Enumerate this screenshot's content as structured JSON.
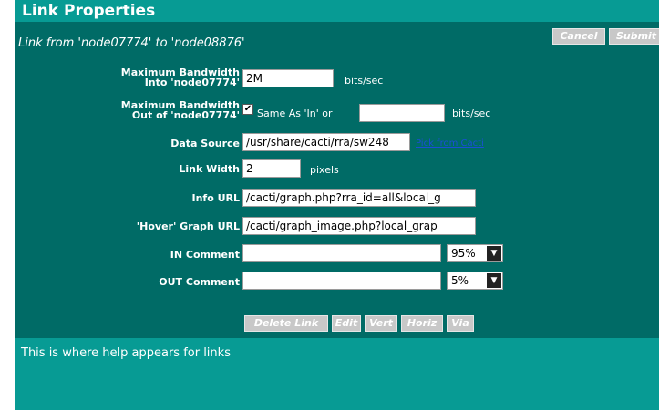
{
  "dialog": {
    "title": "Link Properties",
    "subtitle": "Link from 'node07774' to 'node08876'"
  },
  "header_buttons": {
    "cancel": "Cancel",
    "submit": "Submit"
  },
  "fields": {
    "max_bw_in": {
      "label_line1": "Maximum Bandwidth",
      "label_line2": "Into 'node07774'",
      "value": "2M",
      "unit": "bits/sec"
    },
    "max_bw_out": {
      "label_line1": "Maximum Bandwidth",
      "label_line2": "Out of 'node07774'",
      "checkbox_checked": true,
      "checkbox_check": "✔",
      "same_as_in": "Same As 'In' or",
      "value": "",
      "unit": "bits/sec"
    },
    "data_source": {
      "label": "Data Source",
      "value": "/usr/share/cacti/rra/sw248",
      "link_text": "Pick from Cacti"
    },
    "link_width": {
      "label": "Link Width",
      "value": "2",
      "unit": "pixels"
    },
    "info_url": {
      "label": "Info URL",
      "value": "/cacti/graph.php?rra_id=all&local_g"
    },
    "hover_url": {
      "label": "'Hover' Graph URL",
      "value": "/cacti/graph_image.php?local_grap"
    },
    "in_comment": {
      "label": "IN Comment",
      "value": "",
      "position": "95%"
    },
    "out_comment": {
      "label": "OUT Comment",
      "value": "",
      "position": "5%"
    }
  },
  "action_buttons": {
    "delete_link": "Delete Link",
    "edit": "Edit",
    "vert": "Vert",
    "horiz": "Horiz",
    "via": "Via"
  },
  "help": {
    "text": "This is where help appears for links"
  },
  "icons": {
    "dropdown_arrow": "▼"
  },
  "colors": {
    "panel": "#006b66",
    "title_bar": "#079b94",
    "button": "#c8c8c8",
    "link": "#1a4fd6"
  }
}
